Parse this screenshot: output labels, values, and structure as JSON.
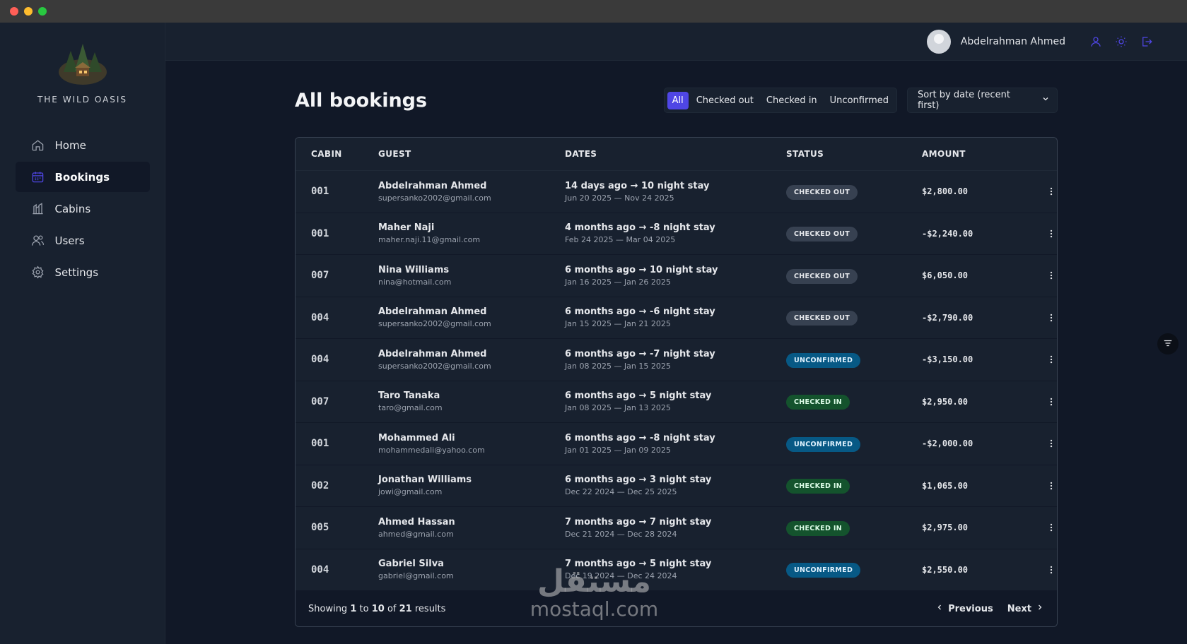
{
  "app": {
    "brand": "THE WILD OASIS"
  },
  "sidebar": {
    "items": [
      {
        "label": "Home",
        "icon": "home-icon",
        "active": false
      },
      {
        "label": "Bookings",
        "icon": "calendar-icon",
        "active": true
      },
      {
        "label": "Cabins",
        "icon": "cabins-icon",
        "active": false
      },
      {
        "label": "Users",
        "icon": "users-icon",
        "active": false
      },
      {
        "label": "Settings",
        "icon": "gear-icon",
        "active": false
      }
    ]
  },
  "header": {
    "username": "Abdelrahman Ahmed"
  },
  "page": {
    "title": "All bookings"
  },
  "filters": {
    "options": [
      "All",
      "Checked out",
      "Checked in",
      "Unconfirmed"
    ],
    "active": "All"
  },
  "sort": {
    "value": "Sort by date (recent first)"
  },
  "table": {
    "columns": [
      "CABIN",
      "GUEST",
      "DATES",
      "STATUS",
      "AMOUNT"
    ],
    "rows": [
      {
        "cabin": "001",
        "guest": "Abdelrahman Ahmed",
        "email": "supersanko2002@gmail.com",
        "dates_main": "14 days ago → 10 night stay",
        "dates_range": "Jun 20 2025 — Nov 24 2025",
        "status": "CHECKED OUT",
        "status_type": "out",
        "amount": "$2,800.00"
      },
      {
        "cabin": "001",
        "guest": "Maher Naji",
        "email": "maher.naji.11@gmail.com",
        "dates_main": "4 months ago → -8 night stay",
        "dates_range": "Feb 24 2025 — Mar 04 2025",
        "status": "CHECKED OUT",
        "status_type": "out",
        "amount": "-$2,240.00"
      },
      {
        "cabin": "007",
        "guest": "Nina Williams",
        "email": "nina@hotmail.com",
        "dates_main": "6 months ago → 10 night stay",
        "dates_range": "Jan 16 2025 — Jan 26 2025",
        "status": "CHECKED OUT",
        "status_type": "out",
        "amount": "$6,050.00"
      },
      {
        "cabin": "004",
        "guest": "Abdelrahman Ahmed",
        "email": "supersanko2002@gmail.com",
        "dates_main": "6 months ago → -6 night stay",
        "dates_range": "Jan 15 2025 — Jan 21 2025",
        "status": "CHECKED OUT",
        "status_type": "out",
        "amount": "-$2,790.00"
      },
      {
        "cabin": "004",
        "guest": "Abdelrahman Ahmed",
        "email": "supersanko2002@gmail.com",
        "dates_main": "6 months ago → -7 night stay",
        "dates_range": "Jan 08 2025 — Jan 15 2025",
        "status": "UNCONFIRMED",
        "status_type": "unc",
        "amount": "-$3,150.00"
      },
      {
        "cabin": "007",
        "guest": "Taro Tanaka",
        "email": "taro@gmail.com",
        "dates_main": "6 months ago → 5 night stay",
        "dates_range": "Jan 08 2025 — Jan 13 2025",
        "status": "CHECKED IN",
        "status_type": "in",
        "amount": "$2,950.00"
      },
      {
        "cabin": "001",
        "guest": "Mohammed Ali",
        "email": "mohammedali@yahoo.com",
        "dates_main": "6 months ago → -8 night stay",
        "dates_range": "Jan 01 2025 — Jan 09 2025",
        "status": "UNCONFIRMED",
        "status_type": "unc",
        "amount": "-$2,000.00"
      },
      {
        "cabin": "002",
        "guest": "Jonathan Williams",
        "email": "jowi@gmail.com",
        "dates_main": "6 months ago → 3 night stay",
        "dates_range": "Dec 22 2024 — Dec 25 2025",
        "status": "CHECKED IN",
        "status_type": "in",
        "amount": "$1,065.00"
      },
      {
        "cabin": "005",
        "guest": "Ahmed Hassan",
        "email": "ahmed@gmail.com",
        "dates_main": "7 months ago → 7 night stay",
        "dates_range": "Dec 21 2024 — Dec 28 2024",
        "status": "CHECKED IN",
        "status_type": "in",
        "amount": "$2,975.00"
      },
      {
        "cabin": "004",
        "guest": "Gabriel Silva",
        "email": "gabriel@gmail.com",
        "dates_main": "7 months ago → 5 night stay",
        "dates_range": "Dec 19 2024 — Dec 24 2024",
        "status": "UNCONFIRMED",
        "status_type": "unc",
        "amount": "$2,550.00"
      }
    ]
  },
  "pagination": {
    "prefix": "Showing",
    "from": "1",
    "to_word": "to",
    "to": "10",
    "of_word": "of",
    "total": "21",
    "suffix": "results",
    "previous": "Previous",
    "next": "Next"
  },
  "watermark": {
    "arabic": "مستقل",
    "latin": "mostaql.com"
  },
  "colors": {
    "accent": "#4f46e5",
    "background": "#111827",
    "panel": "#18212f"
  }
}
